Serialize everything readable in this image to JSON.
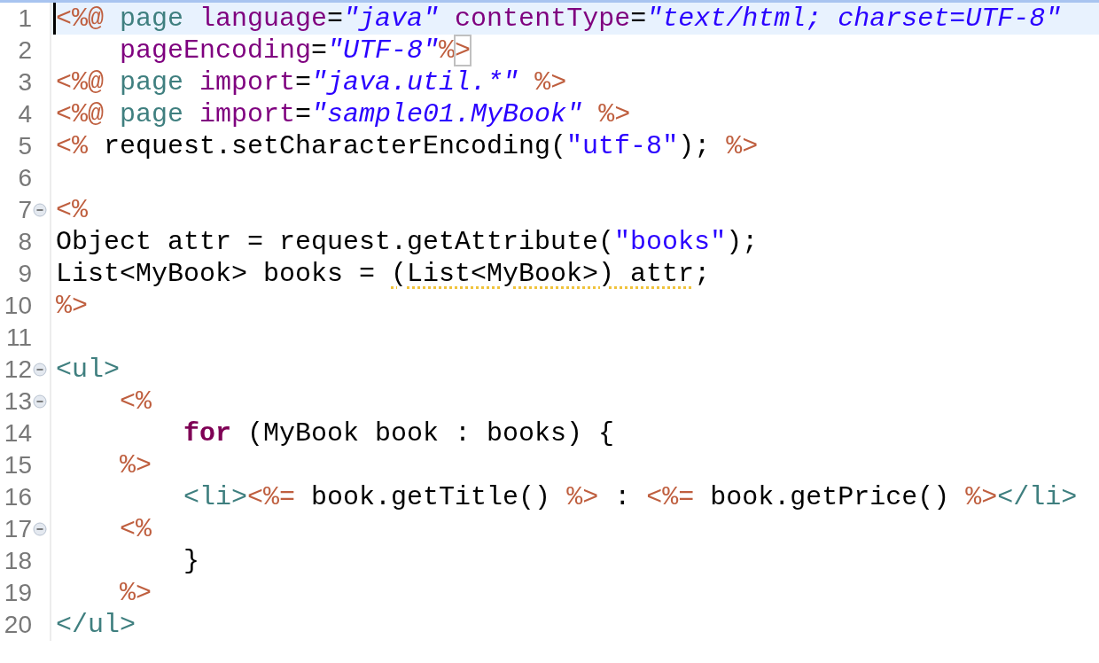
{
  "editor": {
    "lines": [
      {
        "number": "1",
        "fold": false,
        "current": true,
        "cursor": true,
        "tokens": [
          {
            "kind": "delim",
            "text": "<%@"
          },
          {
            "kind": "directive",
            "text": " page"
          },
          {
            "kind": "attr",
            "text": " language"
          },
          {
            "kind": "plain",
            "text": "="
          },
          {
            "kind": "value",
            "text": "\"java\""
          },
          {
            "kind": "attr",
            "text": " contentType"
          },
          {
            "kind": "plain",
            "text": "="
          },
          {
            "kind": "value",
            "text": "\"text/html; charset=UTF-8\""
          }
        ]
      },
      {
        "number": "2",
        "fold": false,
        "current": false,
        "cursor": false,
        "tokens": [
          {
            "kind": "attr",
            "text": "    pageEncoding"
          },
          {
            "kind": "plain",
            "text": "="
          },
          {
            "kind": "value",
            "text": "\"UTF-8\""
          },
          {
            "kind": "delim",
            "text": "%"
          },
          {
            "kind": "delim",
            "text": ">",
            "matched": true
          }
        ]
      },
      {
        "number": "3",
        "fold": false,
        "current": false,
        "cursor": false,
        "tokens": [
          {
            "kind": "delim",
            "text": "<%@"
          },
          {
            "kind": "directive",
            "text": " page"
          },
          {
            "kind": "attr",
            "text": " import"
          },
          {
            "kind": "plain",
            "text": "="
          },
          {
            "kind": "value",
            "text": "\"java.util.*\""
          },
          {
            "kind": "delim",
            "text": " %>"
          }
        ]
      },
      {
        "number": "4",
        "fold": false,
        "current": false,
        "cursor": false,
        "tokens": [
          {
            "kind": "delim",
            "text": "<%@"
          },
          {
            "kind": "directive",
            "text": " page"
          },
          {
            "kind": "attr",
            "text": " import"
          },
          {
            "kind": "plain",
            "text": "="
          },
          {
            "kind": "value",
            "text": "\"sample01.MyBook\""
          },
          {
            "kind": "delim",
            "text": " %>"
          }
        ]
      },
      {
        "number": "5",
        "fold": false,
        "current": false,
        "cursor": false,
        "tokens": [
          {
            "kind": "delim",
            "text": "<%"
          },
          {
            "kind": "plain",
            "text": " request.setCharacterEncoding("
          },
          {
            "kind": "string",
            "text": "\"utf-8\""
          },
          {
            "kind": "plain",
            "text": "); "
          },
          {
            "kind": "delim",
            "text": "%>"
          }
        ]
      },
      {
        "number": "6",
        "fold": false,
        "current": false,
        "cursor": false
      },
      {
        "number": "7",
        "fold": true,
        "current": false,
        "cursor": false,
        "tokens": [
          {
            "kind": "delim",
            "text": "<%"
          }
        ]
      },
      {
        "number": "8",
        "fold": false,
        "current": false,
        "cursor": false,
        "tokens": [
          {
            "kind": "plain",
            "text": "Object attr = request.getAttribute("
          },
          {
            "kind": "string",
            "text": "\"books\""
          },
          {
            "kind": "plain",
            "text": ");"
          }
        ]
      },
      {
        "number": "9",
        "fold": false,
        "current": false,
        "cursor": false,
        "tokens": [
          {
            "kind": "plain",
            "text": "List<MyBook> books = "
          },
          {
            "kind": "plain",
            "text": "(List<MyBook>) attr",
            "warning": true
          },
          {
            "kind": "plain",
            "text": ";"
          }
        ]
      },
      {
        "number": "10",
        "fold": false,
        "current": false,
        "cursor": false,
        "tokens": [
          {
            "kind": "delim",
            "text": "%>"
          }
        ]
      },
      {
        "number": "11",
        "fold": false,
        "current": false,
        "cursor": false
      },
      {
        "number": "12",
        "fold": true,
        "current": false,
        "cursor": false,
        "tokens": [
          {
            "kind": "tag",
            "text": "<ul>"
          }
        ]
      },
      {
        "number": "13",
        "fold": true,
        "current": false,
        "cursor": false,
        "tokens": [
          {
            "kind": "delim",
            "text": "    <%"
          }
        ]
      },
      {
        "number": "14",
        "fold": false,
        "current": false,
        "cursor": false,
        "tokens": [
          {
            "kind": "keyword",
            "text": "        for"
          },
          {
            "kind": "plain",
            "text": " (MyBook book : books) {"
          }
        ]
      },
      {
        "number": "15",
        "fold": false,
        "current": false,
        "cursor": false,
        "tokens": [
          {
            "kind": "delim",
            "text": "    %>"
          }
        ]
      },
      {
        "number": "16",
        "fold": false,
        "current": false,
        "cursor": false,
        "tokens": [
          {
            "kind": "tag",
            "text": "        <li>"
          },
          {
            "kind": "delim",
            "text": "<%="
          },
          {
            "kind": "plain",
            "text": " book.getTitle() "
          },
          {
            "kind": "delim",
            "text": "%>"
          },
          {
            "kind": "plain",
            "text": " : "
          },
          {
            "kind": "delim",
            "text": "<%="
          },
          {
            "kind": "plain",
            "text": " book.getPrice() "
          },
          {
            "kind": "delim",
            "text": "%>"
          },
          {
            "kind": "tag",
            "text": "</li>"
          }
        ]
      },
      {
        "number": "17",
        "fold": true,
        "current": false,
        "cursor": false,
        "tokens": [
          {
            "kind": "delim",
            "text": "    <%"
          }
        ]
      },
      {
        "number": "18",
        "fold": false,
        "current": false,
        "cursor": false,
        "tokens": [
          {
            "kind": "plain",
            "text": "        }"
          }
        ]
      },
      {
        "number": "19",
        "fold": false,
        "current": false,
        "cursor": false,
        "tokens": [
          {
            "kind": "delim",
            "text": "    %>"
          }
        ]
      },
      {
        "number": "20",
        "fold": false,
        "current": false,
        "cursor": false,
        "tokens": [
          {
            "kind": "tag",
            "text": "</ul>"
          }
        ]
      }
    ]
  }
}
